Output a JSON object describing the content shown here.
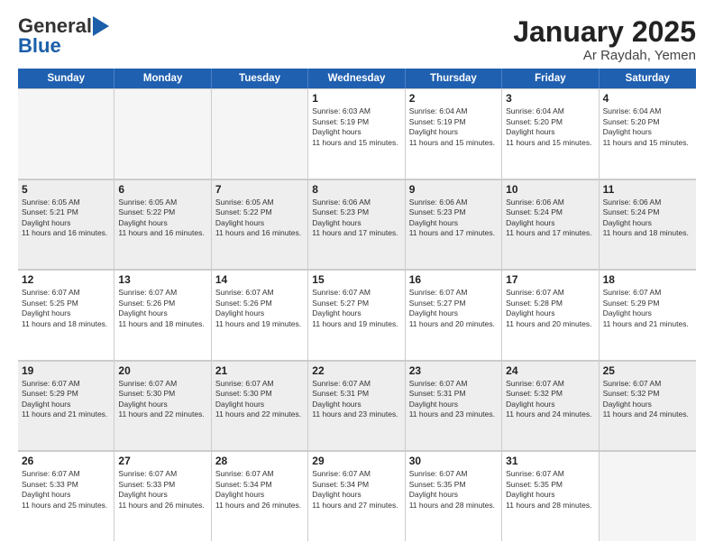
{
  "header": {
    "logo_general": "General",
    "logo_blue": "Blue",
    "title": "January 2025",
    "subtitle": "Ar Raydah, Yemen"
  },
  "days_of_week": [
    "Sunday",
    "Monday",
    "Tuesday",
    "Wednesday",
    "Thursday",
    "Friday",
    "Saturday"
  ],
  "weeks": [
    [
      {
        "day": "",
        "empty": true
      },
      {
        "day": "",
        "empty": true
      },
      {
        "day": "",
        "empty": true
      },
      {
        "day": "1",
        "sunrise": "6:03 AM",
        "sunset": "5:19 PM",
        "daylight": "11 hours and 15 minutes."
      },
      {
        "day": "2",
        "sunrise": "6:04 AM",
        "sunset": "5:19 PM",
        "daylight": "11 hours and 15 minutes."
      },
      {
        "day": "3",
        "sunrise": "6:04 AM",
        "sunset": "5:20 PM",
        "daylight": "11 hours and 15 minutes."
      },
      {
        "day": "4",
        "sunrise": "6:04 AM",
        "sunset": "5:20 PM",
        "daylight": "11 hours and 15 minutes."
      }
    ],
    [
      {
        "day": "5",
        "sunrise": "6:05 AM",
        "sunset": "5:21 PM",
        "daylight": "11 hours and 16 minutes."
      },
      {
        "day": "6",
        "sunrise": "6:05 AM",
        "sunset": "5:22 PM",
        "daylight": "11 hours and 16 minutes."
      },
      {
        "day": "7",
        "sunrise": "6:05 AM",
        "sunset": "5:22 PM",
        "daylight": "11 hours and 16 minutes."
      },
      {
        "day": "8",
        "sunrise": "6:06 AM",
        "sunset": "5:23 PM",
        "daylight": "11 hours and 17 minutes."
      },
      {
        "day": "9",
        "sunrise": "6:06 AM",
        "sunset": "5:23 PM",
        "daylight": "11 hours and 17 minutes."
      },
      {
        "day": "10",
        "sunrise": "6:06 AM",
        "sunset": "5:24 PM",
        "daylight": "11 hours and 17 minutes."
      },
      {
        "day": "11",
        "sunrise": "6:06 AM",
        "sunset": "5:24 PM",
        "daylight": "11 hours and 18 minutes."
      }
    ],
    [
      {
        "day": "12",
        "sunrise": "6:07 AM",
        "sunset": "5:25 PM",
        "daylight": "11 hours and 18 minutes."
      },
      {
        "day": "13",
        "sunrise": "6:07 AM",
        "sunset": "5:26 PM",
        "daylight": "11 hours and 18 minutes."
      },
      {
        "day": "14",
        "sunrise": "6:07 AM",
        "sunset": "5:26 PM",
        "daylight": "11 hours and 19 minutes."
      },
      {
        "day": "15",
        "sunrise": "6:07 AM",
        "sunset": "5:27 PM",
        "daylight": "11 hours and 19 minutes."
      },
      {
        "day": "16",
        "sunrise": "6:07 AM",
        "sunset": "5:27 PM",
        "daylight": "11 hours and 20 minutes."
      },
      {
        "day": "17",
        "sunrise": "6:07 AM",
        "sunset": "5:28 PM",
        "daylight": "11 hours and 20 minutes."
      },
      {
        "day": "18",
        "sunrise": "6:07 AM",
        "sunset": "5:29 PM",
        "daylight": "11 hours and 21 minutes."
      }
    ],
    [
      {
        "day": "19",
        "sunrise": "6:07 AM",
        "sunset": "5:29 PM",
        "daylight": "11 hours and 21 minutes."
      },
      {
        "day": "20",
        "sunrise": "6:07 AM",
        "sunset": "5:30 PM",
        "daylight": "11 hours and 22 minutes."
      },
      {
        "day": "21",
        "sunrise": "6:07 AM",
        "sunset": "5:30 PM",
        "daylight": "11 hours and 22 minutes."
      },
      {
        "day": "22",
        "sunrise": "6:07 AM",
        "sunset": "5:31 PM",
        "daylight": "11 hours and 23 minutes."
      },
      {
        "day": "23",
        "sunrise": "6:07 AM",
        "sunset": "5:31 PM",
        "daylight": "11 hours and 23 minutes."
      },
      {
        "day": "24",
        "sunrise": "6:07 AM",
        "sunset": "5:32 PM",
        "daylight": "11 hours and 24 minutes."
      },
      {
        "day": "25",
        "sunrise": "6:07 AM",
        "sunset": "5:32 PM",
        "daylight": "11 hours and 24 minutes."
      }
    ],
    [
      {
        "day": "26",
        "sunrise": "6:07 AM",
        "sunset": "5:33 PM",
        "daylight": "11 hours and 25 minutes."
      },
      {
        "day": "27",
        "sunrise": "6:07 AM",
        "sunset": "5:33 PM",
        "daylight": "11 hours and 26 minutes."
      },
      {
        "day": "28",
        "sunrise": "6:07 AM",
        "sunset": "5:34 PM",
        "daylight": "11 hours and 26 minutes."
      },
      {
        "day": "29",
        "sunrise": "6:07 AM",
        "sunset": "5:34 PM",
        "daylight": "11 hours and 27 minutes."
      },
      {
        "day": "30",
        "sunrise": "6:07 AM",
        "sunset": "5:35 PM",
        "daylight": "11 hours and 28 minutes."
      },
      {
        "day": "31",
        "sunrise": "6:07 AM",
        "sunset": "5:35 PM",
        "daylight": "11 hours and 28 minutes."
      },
      {
        "day": "",
        "empty": true
      }
    ]
  ]
}
